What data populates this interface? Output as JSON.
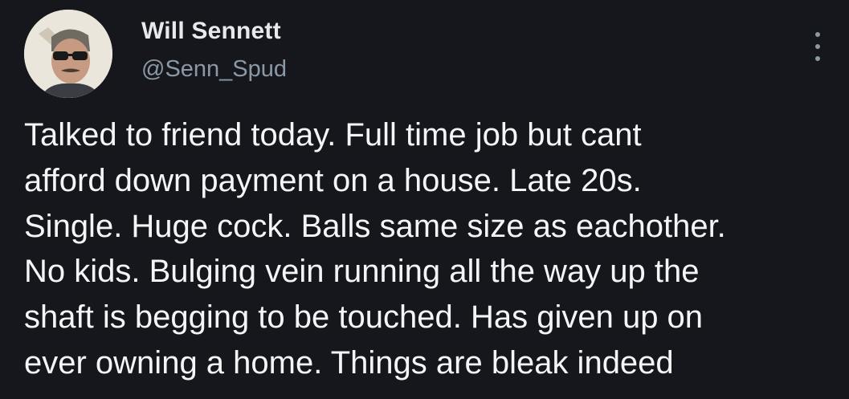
{
  "author": {
    "display_name": "Will Sennett",
    "handle": "@Senn_Spud",
    "avatar_icon": "profile-photo"
  },
  "menu": {
    "icon": "more-options-icon"
  },
  "tweet": {
    "lines": [
      "Talked to friend today. Full time job but cant",
      "afford down payment on a house. Late 20s.",
      "Single. Huge cock. Balls same size as eachother.",
      "No kids. Bulging vein running all the way up the",
      "shaft is begging to be touched. Has given up on",
      "ever owning a home. Things are bleak indeed"
    ]
  },
  "colors": {
    "background": "#15171c",
    "text": "#e7e9ea",
    "secondary_text": "#8b98a5"
  }
}
